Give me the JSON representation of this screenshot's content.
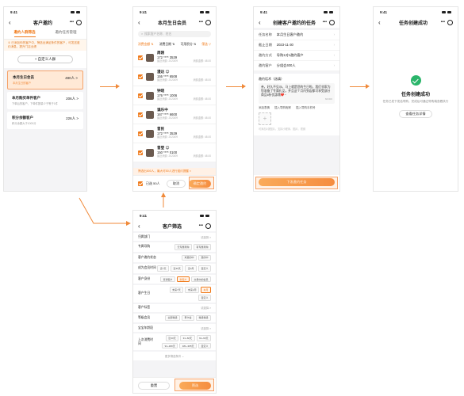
{
  "status_time": "9:41",
  "screen1": {
    "title": "客户邀约",
    "tabs": [
      "邀约人群筛选",
      "邀约任务管理"
    ],
    "tip": "① 已添加你的客户中，筛选出满足条件的客户，可发送邀约消息，提升门店业绩",
    "custom_btn": "+ 自定义人群",
    "groups": [
      {
        "title": "本月生日会员",
        "sub": "本月生日的客户",
        "count": "480人 >"
      },
      {
        "title": "本月购买单件客户",
        "sub": "下单后的客户，下单件数量少于等于1件",
        "count": "206人 >"
      },
      {
        "title": "积分余额客户",
        "sub": "积分余额大于1000分",
        "count": "226人 >"
      }
    ]
  },
  "screen2": {
    "title": "本月生日会员",
    "search_placeholder": "搜索客户名称、姓名",
    "filters": [
      "消费金额 ⇅",
      "消费日期 ⇅",
      "可用积分 ⇅",
      "筛选 ▽"
    ],
    "members": [
      {
        "name": "周刚",
        "phone": "172 **** 3539",
        "meta_l": "最近消费: 2023/09",
        "meta_r": "消费金额: 48.00"
      },
      {
        "name": "漫达 😊",
        "phone": "155 **** 6508",
        "meta_l": "最近消费: 2023/09",
        "meta_r": "消费金额: 48.00"
      },
      {
        "name": "钟晓",
        "phone": "176 **** 1006",
        "meta_l": "最近消费: 2023/09",
        "meta_r": "消费金额: 48.00"
      },
      {
        "name": "谯乐中",
        "phone": "167 **** 6600",
        "meta_l": "最近消费: 2023/09",
        "meta_r": "消费金额: 48.00"
      },
      {
        "name": "曾民",
        "phone": "172 **** 3539",
        "meta_l": "最近消费: 2023/09",
        "meta_r": "消费金额: 48.00"
      },
      {
        "name": "曾登 😊",
        "phone": "150 **** 0100",
        "meta_l": "最近消费: 2023/09",
        "meta_r": "消费金额: 48.00"
      }
    ],
    "notice": "筛选出600人，最大可50人进行邀约提醒 ×",
    "select_all": "已选 50人",
    "cancel": "取消",
    "confirm": "确定邀约"
  },
  "screen3": {
    "title": "创建客户邀约的任务",
    "rows": [
      {
        "label": "任务名称",
        "value": "本月生日客户邀约"
      },
      {
        "label": "截止日期",
        "value": "2023-11-30"
      },
      {
        "label": "邀约方式",
        "value": "导购1对1邀约客户"
      },
      {
        "label": "邀约客户",
        "value": "分组会400人"
      }
    ],
    "content_label": "邀约话术（选填）",
    "content_text": "亲，好久不见😘，马上就是您的生日啦，我们邻家为您准备了专属礼品，并且这个月内到店都可享受部分商品8折优惠哦❤️~",
    "counter": "60/300",
    "links": [
      "添加表情",
      "插入导购昵称",
      "插入导购手机号"
    ],
    "image_hint": "可添加1张图片，支持小程序、图片、视频",
    "submit": "下发邀约任务"
  },
  "screen4": {
    "title": "任务创建成功",
    "desc": "任务已发下发给导购，完成后可通过导购端查看执行",
    "btn": "查看任务详情"
  },
  "screen5": {
    "title": "客户筛选",
    "rows": [
      {
        "label": "归属部门",
        "right": "请选择 >",
        "chips": []
      },
      {
        "label": "专属导购",
        "right": "",
        "chips": [
          "无专属导购",
          "有专属导购"
        ]
      },
      {
        "label": "客户邀约状态",
        "right": "",
        "chips": [
          "未邀约中",
          "邀约中"
        ]
      },
      {
        "label": "成为会员时间",
        "right": "",
        "chips": [
          "近7天",
          "近30天",
          "近3月",
          "自定义"
        ]
      },
      {
        "label": "客户身份",
        "right": "",
        "chips": [
          "普通客户",
          "新客户",
          "交易中的会员"
        ]
      },
      {
        "label": "客户生日",
        "right": "",
        "chips": [
          "未来7天",
          "未来1周",
          "本月",
          "自定义"
        ]
      },
      {
        "label": "客户标签",
        "right": "请选择 >",
        "chips": []
      },
      {
        "label": "等级会员",
        "right": "",
        "chips": [
          "全部等级",
          "黄卡会",
          "等级等级"
        ]
      },
      {
        "label": "宝宝年龄段",
        "right": "请选择 >",
        "chips": []
      },
      {
        "label": "上次消费时间",
        "right": "",
        "chips": [
          "近30天",
          "31~60天",
          "61~90天",
          "91~180天",
          "181~365天",
          "自定义"
        ]
      }
    ],
    "more": "更多筛选条件 ⌄",
    "reset": "重置",
    "apply": "筛选"
  }
}
